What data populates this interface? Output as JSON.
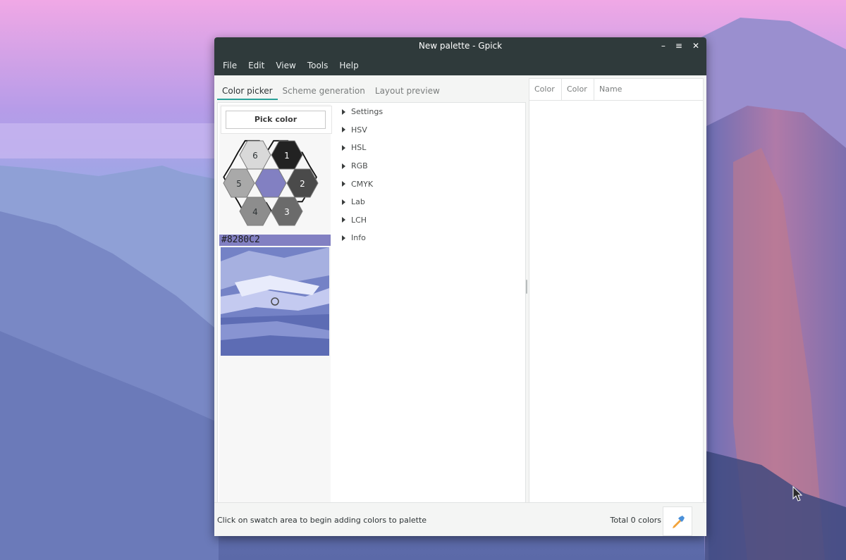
{
  "window": {
    "title": "New palette - Gpick",
    "controls": {
      "minimize": "–",
      "maximize": "≡",
      "close": "✕"
    }
  },
  "menu": [
    "File",
    "Edit",
    "View",
    "Tools",
    "Help"
  ],
  "tabs": [
    "Color picker",
    "Scheme generation",
    "Layout preview"
  ],
  "picker": {
    "pick_label": "Pick color",
    "hex_value": "#8280C2",
    "hex_swatches": [
      {
        "label": "6",
        "color": "#d9d9d9"
      },
      {
        "label": "1",
        "color": "#222222"
      },
      {
        "label": "5",
        "color": "#a9a9a9"
      },
      {
        "label": "",
        "color": "#8280c2"
      },
      {
        "label": "2",
        "color": "#4a4a4a"
      },
      {
        "label": "4",
        "color": "#8d8d8d"
      },
      {
        "label": "3",
        "color": "#6b6b6b"
      }
    ]
  },
  "tree": [
    "Settings",
    "HSV",
    "HSL",
    "RGB",
    "CMYK",
    "Lab",
    "LCH",
    "Info"
  ],
  "palette_columns": [
    "Color",
    "Color",
    "Name"
  ],
  "status": {
    "hint": "Click on swatch area to begin adding colors to palette",
    "total": "Total 0 colors"
  },
  "colors": {
    "titlebar": "#2f3a3b",
    "accent": "#2aa198",
    "selected": "#8280c2"
  }
}
